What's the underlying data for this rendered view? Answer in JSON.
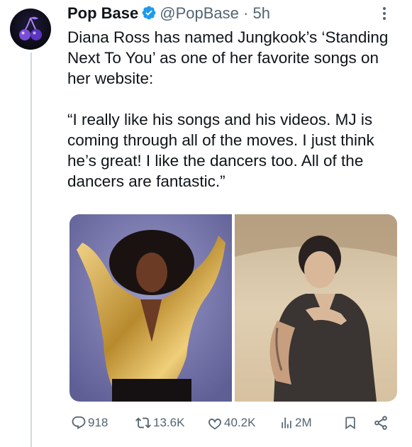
{
  "tweet": {
    "author_name": "Pop Base",
    "handle": "@PopBase",
    "separator": "·",
    "time": "5h",
    "paragraphs": [
      "Diana Ross has named Jungkook’s ‘Standing Next To You’ as one of her favorite songs on her website:",
      "“I really like his songs and his videos. MJ is coming through all of the moves.  I just think he’s great!  I like the dancers too. All of the dancers are fantastic.”"
    ]
  },
  "actions": {
    "replies": "918",
    "reposts": "13.6K",
    "likes": "40.2K",
    "views": "2M"
  },
  "icons": {
    "avatar": "cherries-logo",
    "verified": "verified-badge-icon",
    "more": "more-icon",
    "reply": "reply-icon",
    "repost": "repost-icon",
    "like": "heart-icon",
    "views": "views-icon",
    "bookmark": "bookmark-icon",
    "share": "share-icon"
  },
  "colors": {
    "verified": "#1d9bf0",
    "text": "#0f1419",
    "muted": "#536471",
    "thread_line": "#cfd9de"
  }
}
